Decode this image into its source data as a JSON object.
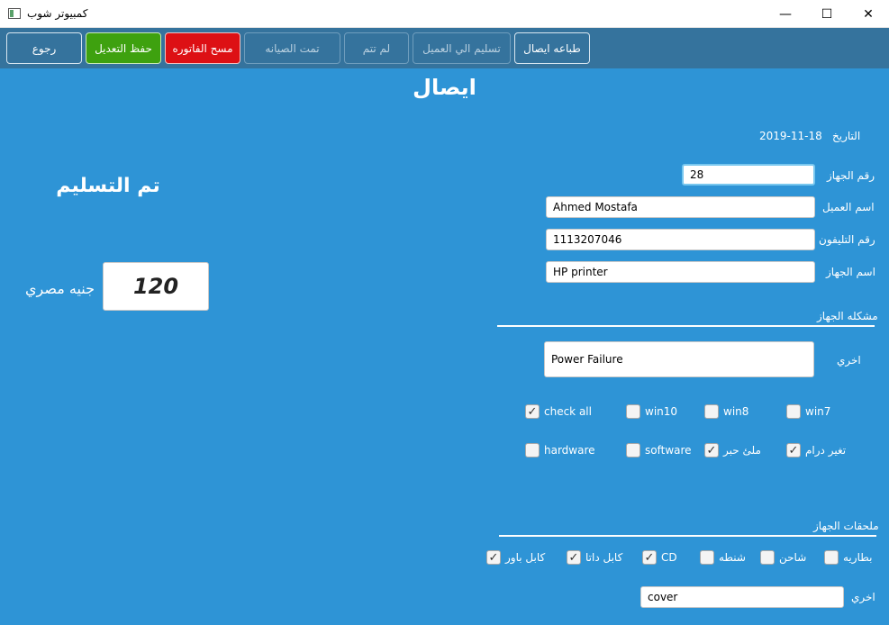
{
  "window": {
    "title": "كمبيوتر شوب",
    "minimize_glyph": "—",
    "maximize_glyph": "☐",
    "close_glyph": "✕"
  },
  "toolbar": {
    "back": "رجوع",
    "save_edit": "حفظ التعديل",
    "delete_invoice": "مسح الفاتوره",
    "maintenance_done": "تمت الصيانه",
    "not_done": "لم تتم",
    "deliver_to_client": "تسليم الي العميل",
    "print_receipt": "طباعه ايصال"
  },
  "page": {
    "heading": "ايصال",
    "date_label": "التاريخ",
    "date_value": "2019-11-18",
    "status": "تم التسليم",
    "price": "120",
    "currency": "جنيه مصري"
  },
  "form": {
    "device_no_label": "رقم الجهاز",
    "device_no_value": "28",
    "client_name_label": "اسم العميل",
    "client_name_value": "Ahmed Mostafa",
    "phone_label": "رقم التليفون",
    "phone_value": "1113207046",
    "device_name_label": "اسم الجهاز",
    "device_name_value": "HP printer"
  },
  "problem": {
    "section_label": "مشكله الجهاز",
    "other_label": "اخري",
    "other_value": "Power Failure",
    "options": [
      {
        "label": "check all",
        "checked": true
      },
      {
        "label": "win10",
        "checked": false
      },
      {
        "label": "win8",
        "checked": false
      },
      {
        "label": "win7",
        "checked": false
      },
      {
        "label": "hardware",
        "checked": false
      },
      {
        "label": "software",
        "checked": false
      },
      {
        "label": "ملئ حبر",
        "checked": true
      },
      {
        "label": "تغير درام",
        "checked": true
      }
    ]
  },
  "accessories": {
    "section_label": "ملحقات الجهاز",
    "other_label": "اخري",
    "other_value": "cover",
    "options": [
      {
        "label": "كابل باور",
        "checked": true
      },
      {
        "label": "كابل داتا",
        "checked": true
      },
      {
        "label": "CD",
        "checked": true
      },
      {
        "label": "شنطه",
        "checked": false
      },
      {
        "label": "شاحن",
        "checked": false
      },
      {
        "label": "بطاريه",
        "checked": false
      }
    ]
  },
  "colors": {
    "toolbar_bg": "#35739d",
    "main_bg": "#2e94d6",
    "delete_button": "#dd1014",
    "save_button": "#3ea10f"
  },
  "check_glyph": "✓"
}
